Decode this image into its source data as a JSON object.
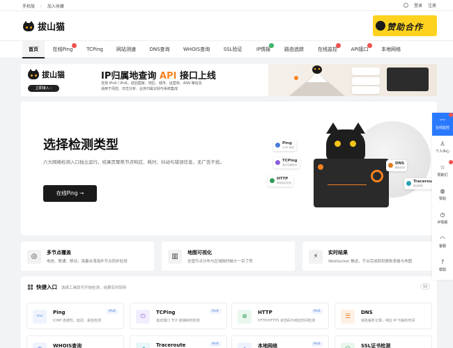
{
  "topbar": {
    "links": [
      "手机版",
      "加入收藏"
    ],
    "login": "登录",
    "register": "注册"
  },
  "header": {
    "logo_text": "拔山猫",
    "sponsor_text": "赞助合作"
  },
  "nav": {
    "items": [
      {
        "label": "首页",
        "active": true
      },
      {
        "label": "在线Ping",
        "badge": "red"
      },
      {
        "label": "TCPing"
      },
      {
        "label": "网站测速"
      },
      {
        "label": "DNS查询"
      },
      {
        "label": "WHOIS查询"
      },
      {
        "label": "SSL验证"
      },
      {
        "label": "IP情报",
        "badge": "green"
      },
      {
        "label": "路由追踪"
      },
      {
        "label": "在线监控",
        "badge": "red"
      },
      {
        "label": "API接口",
        "badge": "red"
      },
      {
        "label": "本地网络"
      }
    ]
  },
  "ad": {
    "logo_text": "拔山猫",
    "button": "立即接入 ›",
    "title_prefix": "IP归属地查询 ",
    "title_api": "API",
    "title_suffix": " 接口上线",
    "sub1": "支持 IPv4 / IPv6，返回国家、地区、城市、运营商、ASN 等信息",
    "sub2": "适用于风控、日志分析、业务归属识别与系统集成"
  },
  "hero": {
    "title": "选择检测类型",
    "desc": "六大网络检测入口独立运行，结果页聚焦节点响应、耗时、抖动与错误信息，无广告干扰。",
    "cta": "在线Ping →",
    "tags": [
      {
        "name": "Ping",
        "sub": "ICMP 探测"
      },
      {
        "name": "TCPing",
        "sub": "端口连通检测"
      },
      {
        "name": "HTTP",
        "sub": "网站响应检测"
      },
      {
        "name": "DNS",
        "sub": "解析检测"
      },
      {
        "name": "Traceroute",
        "sub": "路由追踪"
      }
    ]
  },
  "features": [
    {
      "icon": "◎",
      "title": "多节点覆盖",
      "desc": "电信、联通、移动，海量台湾海外节点同步检测"
    },
    {
      "icon": "▥",
      "title": "地图可视化",
      "desc": "全国节点分布与区域耗时统计一目了然"
    },
    {
      "icon": "⚡",
      "title": "实时结果",
      "desc": "WebSocket 推送，节点完成即刻更新表格与地图"
    }
  ],
  "quick": {
    "title": "快捷入口",
    "subtitle": "选择工具即可开始检测，结果实时回传",
    "count": "12",
    "tools": [
      {
        "name": "Ping",
        "desc": "ICMP 连通性、延迟、丢包检测",
        "badge": "IPv6",
        "icon": "〰",
        "color": "#eef3fd",
        "fg": "#4a7bd8"
      },
      {
        "name": "TCPing",
        "desc": "指定端口 TCP 连接耗时检测",
        "badge": "IPv6",
        "icon": "⏻",
        "color": "#f3eefd",
        "fg": "#8a5cd8"
      },
      {
        "name": "HTTP",
        "desc": "HTTP/HTTPS 状态码与响应时间检测",
        "badge": "IPv6",
        "icon": "⊕",
        "color": "#eaf7ef",
        "fg": "#2e9d5a"
      },
      {
        "name": "DNS",
        "desc": "域名解析记录，响应 IP 与解析时间",
        "badge": "",
        "icon": "☰",
        "color": "#fdf1e6",
        "fg": "#e07b24"
      },
      {
        "name": "WHOIS查询",
        "desc": "",
        "badge": "",
        "icon": "◉",
        "color": "#eef3fd",
        "fg": "#4a7bd8"
      },
      {
        "name": "Traceroute",
        "desc": "",
        "badge": "IPv6",
        "icon": "↗",
        "color": "#e8f6f8",
        "fg": "#2b9fb2"
      },
      {
        "name": "本地网络",
        "desc": "",
        "badge": "IPv6",
        "icon": "⌂",
        "color": "#eef3fd",
        "fg": "#4a7bd8"
      },
      {
        "name": "SSL证书检测",
        "desc": "",
        "badge": "",
        "icon": "⬡",
        "color": "#eaf7ef",
        "fg": "#2e9d5a"
      }
    ]
  },
  "float": [
    {
      "label": "在线监控",
      "icon": "〰",
      "active": true,
      "dot": true
    },
    {
      "label": "个人中心",
      "icon": "♙"
    },
    {
      "label": "赞助们",
      "icon": "☆",
      "dot": true
    },
    {
      "label": "赞助",
      "icon": "◍"
    },
    {
      "label": "IP情报",
      "icon": "◷"
    },
    {
      "label": "客服",
      "icon": "◠"
    },
    {
      "label": "帮助",
      "icon": "?"
    }
  ]
}
